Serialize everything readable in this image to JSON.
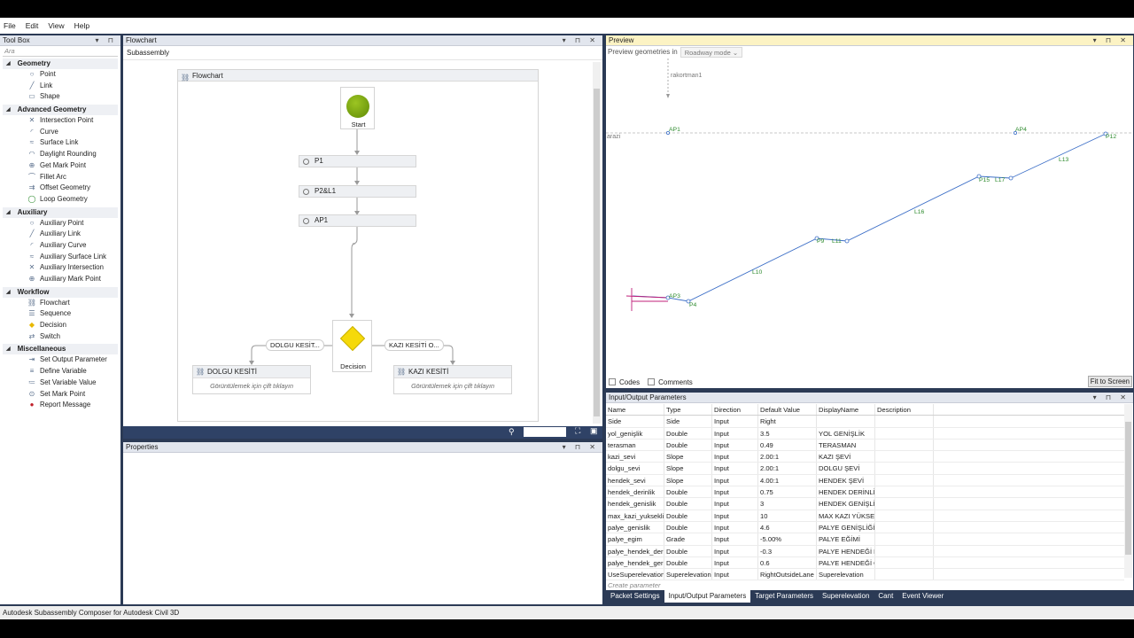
{
  "menu": [
    "File",
    "Edit",
    "View",
    "Help"
  ],
  "toolbox": {
    "title": "Tool Box",
    "search_placeholder": "Ara",
    "groups": [
      {
        "name": "Geometry",
        "items": [
          "Point",
          "Link",
          "Shape"
        ]
      },
      {
        "name": "Advanced Geometry",
        "items": [
          "Intersection Point",
          "Curve",
          "Surface Link",
          "Daylight Rounding",
          "Get Mark Point",
          "Fillet Arc",
          "Offset Geometry",
          "Loop Geometry"
        ]
      },
      {
        "name": "Auxiliary",
        "items": [
          "Auxiliary Point",
          "Auxiliary Link",
          "Auxiliary Curve",
          "Auxiliary Surface Link",
          "Auxiliary Intersection",
          "Auxiliary Mark Point"
        ]
      },
      {
        "name": "Workflow",
        "items": [
          "Flowchart",
          "Sequence",
          "Decision",
          "Switch"
        ]
      },
      {
        "name": "Miscellaneous",
        "items": [
          "Set Output Parameter",
          "Define Variable",
          "Set Variable Value",
          "Set Mark Point",
          "Report Message"
        ]
      }
    ]
  },
  "flowchart": {
    "panel_title": "Flowchart",
    "breadcrumb": "Subassembly",
    "container_title": "Flowchart",
    "start_label": "Start",
    "steps": [
      "P1",
      "P2&L1",
      "AP1"
    ],
    "decision_label": "Decision",
    "left_branch_label": "DOLGU KESİT...",
    "right_branch_label": "KAZI KESİTİ O...",
    "left_box_title": "DOLGU KESİTİ",
    "right_box_title": "KAZI KESİTİ",
    "box_hint": "Görüntülemek için çift tıklayın"
  },
  "properties": {
    "title": "Properties"
  },
  "preview": {
    "title": "Preview",
    "geom_label": "Preview geometries in",
    "mode_value": "Roadway mode",
    "marker_label": "rakortman1",
    "ground_label": "arazi",
    "labels": {
      "ap1": "AP1",
      "ap4": "AP4",
      "p12": "P12",
      "l13": "L13",
      "p15": "P15",
      "l17": "L17",
      "l16": "L16",
      "p9": "P9",
      "l11": "L11",
      "l10": "L10",
      "ap3": "AP3",
      "p4": "P4"
    },
    "codes_label": "Codes",
    "comments_label": "Comments",
    "fit_label": "Fit to Screen"
  },
  "io": {
    "title": "Input/Output Parameters",
    "columns": [
      "Name",
      "Type",
      "Direction",
      "Default Value",
      "DisplayName",
      "Description"
    ],
    "rows": [
      [
        "Side",
        "Side",
        "Input",
        "Right",
        "",
        ""
      ],
      [
        "yol_genişlik",
        "Double",
        "Input",
        "3.5",
        "YOL GENİŞLİK",
        ""
      ],
      [
        "terasman",
        "Double",
        "Input",
        "0.49",
        "TERASMAN",
        ""
      ],
      [
        "kazi_sevi",
        "Slope",
        "Input",
        "2.00:1",
        "KAZI ŞEVİ",
        ""
      ],
      [
        "dolgu_sevi",
        "Slope",
        "Input",
        "2.00:1",
        "DOLGU ŞEVİ",
        ""
      ],
      [
        "hendek_sevi",
        "Slope",
        "Input",
        "4.00:1",
        "HENDEK ŞEVİ",
        ""
      ],
      [
        "hendek_derinlik",
        "Double",
        "Input",
        "0.75",
        "HENDEK DERİNLİK",
        ""
      ],
      [
        "hendek_genislik",
        "Double",
        "Input",
        "3",
        "HENDEK GENİŞLİK",
        ""
      ],
      [
        "max_kazi_yuksekli",
        "Double",
        "Input",
        "10",
        "MAX KAZI YÜKSEKLİK",
        ""
      ],
      [
        "palye_genislik",
        "Double",
        "Input",
        "4.6",
        "PALYE GENİŞLİĞİ",
        ""
      ],
      [
        "palye_egim",
        "Grade",
        "Input",
        "-5.00%",
        "PALYE EĞİMİ",
        ""
      ],
      [
        "palye_hendek_der",
        "Double",
        "Input",
        "-0.3",
        "PALYE HENDEĞİ DERİNLİK",
        ""
      ],
      [
        "palye_hendek_ger",
        "Double",
        "Input",
        "0.6",
        "PALYE HENDEĞİ GENİŞLİK",
        ""
      ],
      [
        "UseSuperelevation",
        "Superelevation",
        "Input",
        "RightOutsideLane",
        "Superelevation",
        ""
      ]
    ],
    "create_placeholder": "Create parameter"
  },
  "tabs": [
    "Packet Settings",
    "Input/Output Parameters",
    "Target Parameters",
    "Superelevation",
    "Cant",
    "Event Viewer"
  ],
  "active_tab": "Input/Output Parameters",
  "status": "Autodesk Subassembly Composer for Autodesk Civil 3D",
  "colors": {
    "accent": "#2b3a55",
    "preview_header": "#fcf3c4",
    "start_node": "#7aa60a",
    "decision_node": "#f5d90a",
    "geometry_line": "#3d6fc7",
    "label_green": "#2e8b2e"
  }
}
